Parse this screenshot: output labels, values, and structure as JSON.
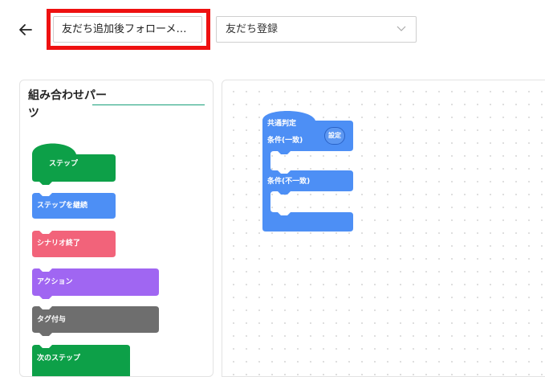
{
  "header": {
    "back_icon": "arrow-left-icon",
    "scenario_name": "友だち追加後フォローメッセージ",
    "trigger_select": "友だち登録"
  },
  "parts_panel": {
    "title": "組み合わせパーツ",
    "blocks": [
      {
        "label": "ステップ",
        "color": "#0da048"
      },
      {
        "label": "ステップを継続",
        "color": "#4d8ff5"
      },
      {
        "label": "シナリオ終了",
        "color": "#f2637a"
      },
      {
        "label": "アクション",
        "color": "#a066f2"
      },
      {
        "label": "タグ付与",
        "color": "#6e6e6e"
      },
      {
        "label": "次のステップ",
        "color": "#0da048"
      }
    ]
  },
  "canvas": {
    "condition_block": {
      "title": "共通判定",
      "match_label": "条件(一致)",
      "nomatch_label": "条件(不一致)",
      "settings_label": "設定",
      "color": "#4d8ff5"
    }
  },
  "colors": {
    "highlight_frame": "#ee1111",
    "divider_accent": "#18a07a"
  }
}
